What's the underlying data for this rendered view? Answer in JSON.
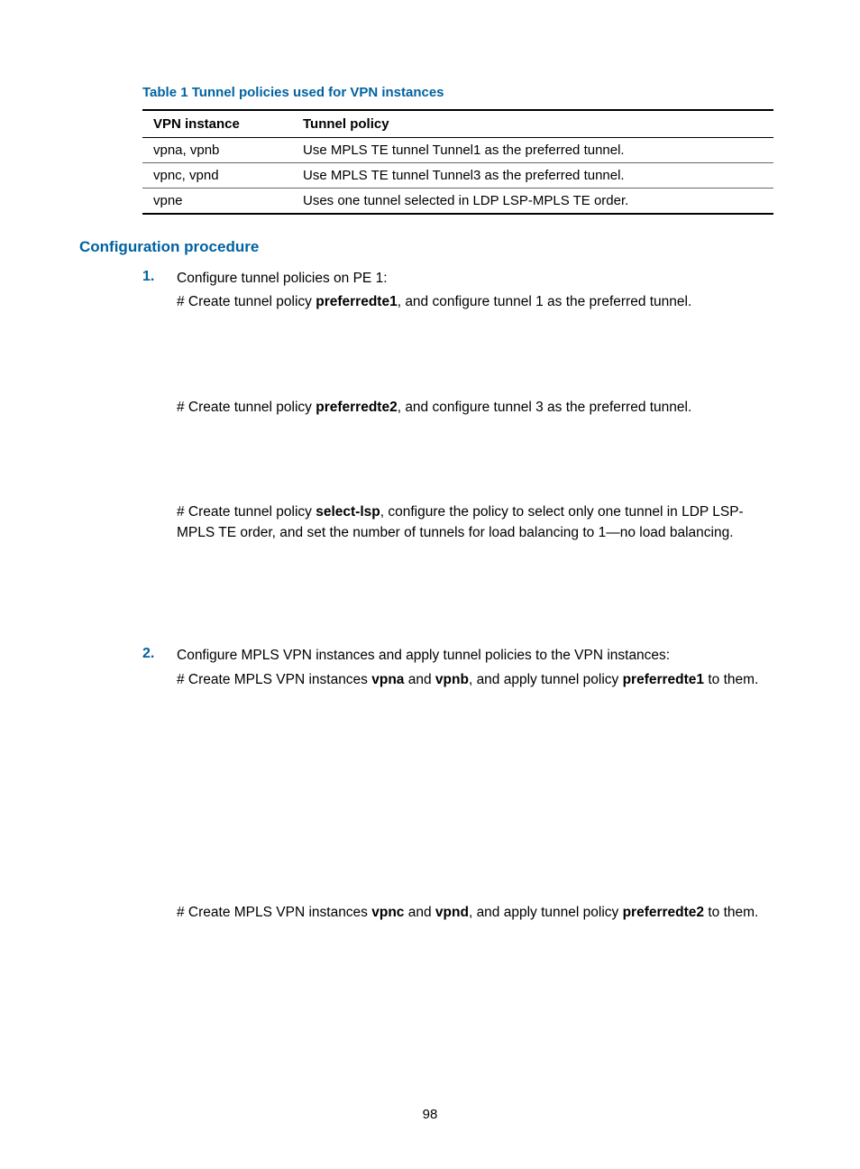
{
  "table": {
    "caption": "Table 1 Tunnel policies used for VPN instances",
    "headers": {
      "col1": "VPN instance",
      "col2": "Tunnel policy"
    },
    "rows": [
      {
        "c1": "vpna, vpnb",
        "c2": "Use MPLS TE tunnel Tunnel1 as the preferred tunnel."
      },
      {
        "c1": "vpnc, vpnd",
        "c2": "Use MPLS TE tunnel Tunnel3 as the preferred tunnel."
      },
      {
        "c1": "vpne",
        "c2": "Uses one tunnel selected in LDP LSP-MPLS TE order."
      }
    ]
  },
  "section_heading": "Configuration procedure",
  "steps": [
    {
      "num": "1.",
      "lead": "Configure tunnel policies on PE 1:",
      "blocks": [
        {
          "pre": "# Create tunnel policy ",
          "bold": "preferredte1",
          "post": ", and configure tunnel 1 as the preferred tunnel.",
          "gap": "gap-small"
        },
        {
          "pre": "# Create tunnel policy ",
          "bold": "preferredte2",
          "post": ", and configure tunnel 3 as the preferred tunnel.",
          "gap": "gap-small"
        },
        {
          "pre": "# Create tunnel policy ",
          "bold": "select-lsp",
          "post": ", configure the policy to select only one tunnel in LDP LSP-MPLS TE order, and set the number of tunnels for load balancing to 1—no load balancing.",
          "gap": "gap-med"
        }
      ]
    },
    {
      "num": "2.",
      "lead": "Configure MPLS VPN instances and apply tunnel policies to the VPN instances:",
      "blocks": [
        {
          "pre": "# Create MPLS VPN instances ",
          "bold": "vpna",
          "mid": " and ",
          "bold2": "vpnb",
          "post_pre": ", and apply tunnel policy ",
          "bold3": "preferredte1",
          "post": " to them.",
          "gap": "gap-large"
        },
        {
          "pre": "# Create MPLS VPN instances ",
          "bold": "vpnc",
          "mid": " and ",
          "bold2": "vpnd",
          "post_pre": ", and apply tunnel policy ",
          "bold3": "preferredte2",
          "post": " to them.",
          "gap": ""
        }
      ]
    }
  ],
  "page_number": "98"
}
